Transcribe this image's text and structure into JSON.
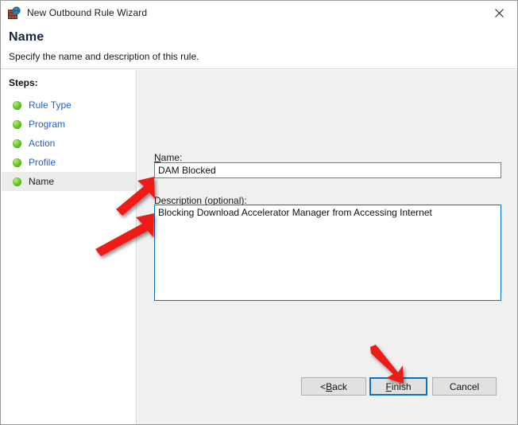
{
  "window": {
    "title": "New Outbound Rule Wizard",
    "icon": "firewall-globe-icon",
    "close_label": "✕"
  },
  "header": {
    "title": "Name",
    "subtitle": "Specify the name and description of this rule."
  },
  "sidebar": {
    "heading": "Steps:",
    "items": [
      {
        "label": "Rule Type",
        "state": "completed"
      },
      {
        "label": "Program",
        "state": "completed"
      },
      {
        "label": "Action",
        "state": "completed"
      },
      {
        "label": "Profile",
        "state": "completed"
      },
      {
        "label": "Name",
        "state": "current"
      }
    ]
  },
  "form": {
    "name": {
      "label_prefix": "",
      "label_accel": "N",
      "label_suffix": "ame:",
      "value": "DAM Blocked",
      "placeholder": ""
    },
    "description": {
      "label_accel": "D",
      "label_suffix": "escription (optional):",
      "value": "Blocking Download Accelerator Manager from Accessing Internet",
      "placeholder": ""
    }
  },
  "buttons": {
    "back": {
      "prefix": "< ",
      "accel": "B",
      "suffix": "ack"
    },
    "finish": {
      "prefix": "",
      "accel": "F",
      "suffix": "inish"
    },
    "cancel": {
      "prefix": "",
      "accel": "",
      "suffix": "Cancel"
    }
  },
  "annotations": {
    "arrows": [
      {
        "name": "arrow-to-name-field",
        "direction": "up-right"
      },
      {
        "name": "arrow-to-description-field",
        "direction": "up-right"
      },
      {
        "name": "arrow-to-finish-button",
        "direction": "down-right"
      }
    ],
    "color": "#ee1c17"
  },
  "colors": {
    "accent_blue": "#0a72c4",
    "link_blue": "#1f5ed6",
    "panel_gray": "#f0f0f0",
    "button_gray": "#e1e1e1",
    "annotation_red": "#ee1c17"
  }
}
